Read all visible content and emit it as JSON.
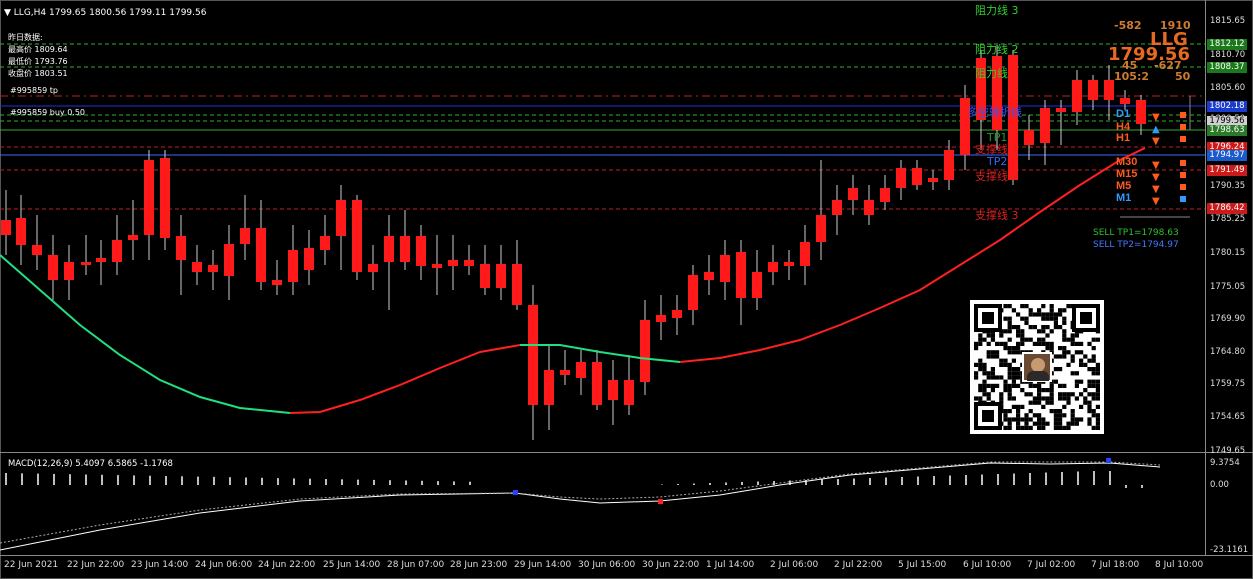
{
  "header": {
    "symbol_line": "LLG,H4  1799.65 1800.56 1799.11 1799.56",
    "info_title": "昨日数据:",
    "high_label": "最高价 1809.64",
    "low_label": "最低价 1793.76",
    "close_label": "收盘价 1803.51",
    "order_tp": "#995859 tp",
    "order_buy": "#995859 buy 0.50"
  },
  "panel": {
    "spread_left": "-582",
    "spread_right": "1910",
    "symbol": "LLG",
    "price": "1799.56",
    "v1": "45",
    "v2": "-627",
    "ratio": "105:2",
    "v3": "50",
    "timeframes": [
      "D1",
      "H4",
      "H1",
      "M30",
      "M15",
      "M5",
      "M1"
    ],
    "sell_tp1": "SELL  TP1=1798.63",
    "sell_tp2": "SELL  TP2=1794.97"
  },
  "levels": {
    "r3": "阻力线 3",
    "r2": "阻力线 2",
    "r1": "阻力线",
    "rev": "多空转折线",
    "tp1": "TP1",
    "s1": "支撑线 1",
    "tp2": "TP2",
    "s2": "支撑线 2",
    "s3": "支撑线 3"
  },
  "price_axis": [
    "1815.65",
    "1810.70",
    "1805.60",
    "1800.50",
    "1795.40",
    "1790.35",
    "1785.25",
    "1780.15",
    "1775.05",
    "1769.90",
    "1764.80",
    "1759.75",
    "1754.65",
    "1749.65"
  ],
  "price_tags": [
    {
      "text": "1812.12",
      "color": "#1a7a1a"
    },
    {
      "text": "1808.37",
      "color": "#1a7a1a"
    },
    {
      "text": "1802.18",
      "color": "#1a3ccc"
    },
    {
      "text": "1799.56",
      "color": "#cfcfcf"
    },
    {
      "text": "1798.63",
      "color": "#2a7a2a"
    },
    {
      "text": "1796.24",
      "color": "#cc1a1a"
    },
    {
      "text": "1794.97",
      "color": "#1a5acc"
    },
    {
      "text": "1791.49",
      "color": "#cc1a1a"
    },
    {
      "text": "1786.42",
      "color": "#cc1a1a"
    }
  ],
  "macd": {
    "label": "MACD(12,26,9) 5.4097 6.5865 -1.1768",
    "axis": [
      "9.3754",
      "0.00",
      "-23.1161"
    ]
  },
  "time_axis": [
    "22 Jun 2021",
    "22 Jun 22:00",
    "23 Jun 14:00",
    "24 Jun 06:00",
    "24 Jun 22:00",
    "25 Jun 14:00",
    "28 Jun 07:00",
    "28 Jun 23:00",
    "29 Jun 14:00",
    "30 Jun 06:00",
    "30 Jun 22:00",
    "1 Jul 14:00",
    "2 Jul 06:00",
    "2 Jul 22:00",
    "5 Jul 15:00",
    "6 Jul 10:00",
    "7 Jul 02:00",
    "7 Jul 18:00",
    "8 Jul 10:00"
  ],
  "colors": {
    "bull": "#00ee88",
    "bear": "#ff1a1a",
    "ma_up": "#ff2020",
    "ma_down": "#20e080"
  }
}
